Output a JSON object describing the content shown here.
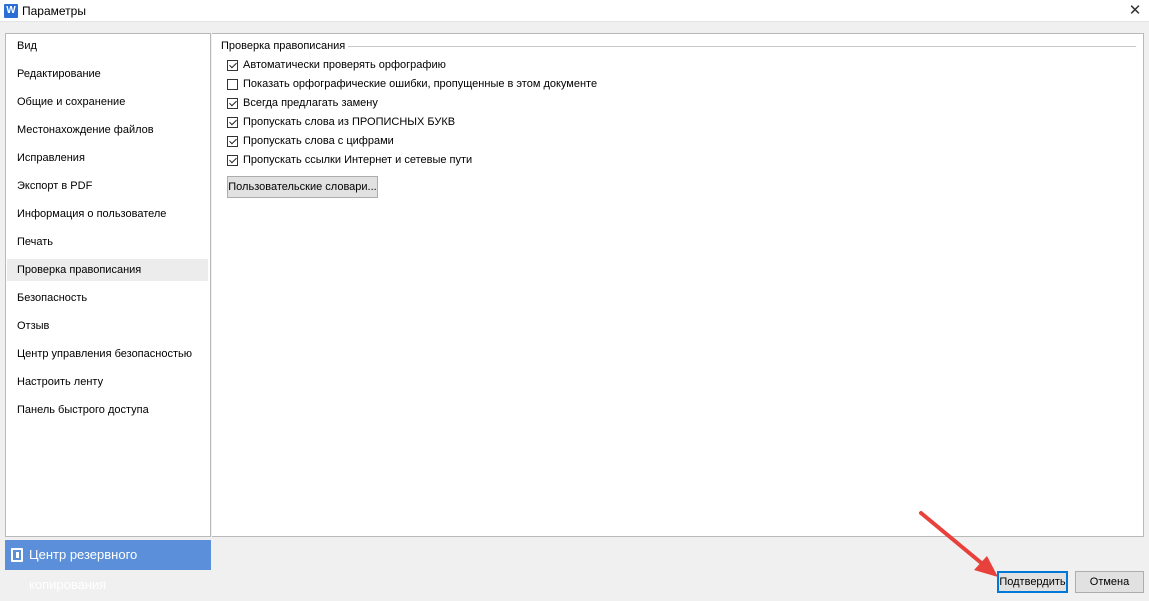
{
  "window": {
    "title": "Параметры",
    "app_icon_letter": "W",
    "close_glyph": "✕"
  },
  "sidebar": {
    "items": [
      {
        "label": "Вид"
      },
      {
        "label": "Редактирование"
      },
      {
        "label": "Общие и сохранение"
      },
      {
        "label": "Местонахождение файлов"
      },
      {
        "label": "Исправления"
      },
      {
        "label": "Экспорт в PDF"
      },
      {
        "label": "Информация о пользователе"
      },
      {
        "label": "Печать"
      },
      {
        "label": "Проверка правописания",
        "selected": true
      },
      {
        "label": "Безопасность"
      },
      {
        "label": "Отзыв"
      },
      {
        "label": "Центр управления безопасностью"
      },
      {
        "label": "Настроить ленту"
      },
      {
        "label": "Панель быстрого доступа"
      }
    ]
  },
  "backup": {
    "label": "Центр резервного копирования",
    "icon": "backup-icon"
  },
  "spelling": {
    "group_title": "Проверка правописания",
    "options": [
      {
        "label": "Автоматически проверять орфографию",
        "checked": true
      },
      {
        "label": "Показать орфографические ошибки, пропущенные в этом документе",
        "checked": false
      },
      {
        "label": "Всегда предлагать замену",
        "checked": true
      },
      {
        "label": "Пропускать слова из ПРОПИСНЫХ БУКВ",
        "checked": true
      },
      {
        "label": "Пропускать слова с цифрами",
        "checked": true
      },
      {
        "label": "Пропускать ссылки Интернет и сетевые пути",
        "checked": true
      }
    ],
    "dictionaries_button": "Пользовательские словари..."
  },
  "footer": {
    "confirm_label": "Подтвердить",
    "cancel_label": "Отмена"
  },
  "colors": {
    "accent": "#0078d7",
    "backup_bar": "#5b8fd9",
    "arrow": "#e8403a",
    "selected_item": "#ececec"
  }
}
